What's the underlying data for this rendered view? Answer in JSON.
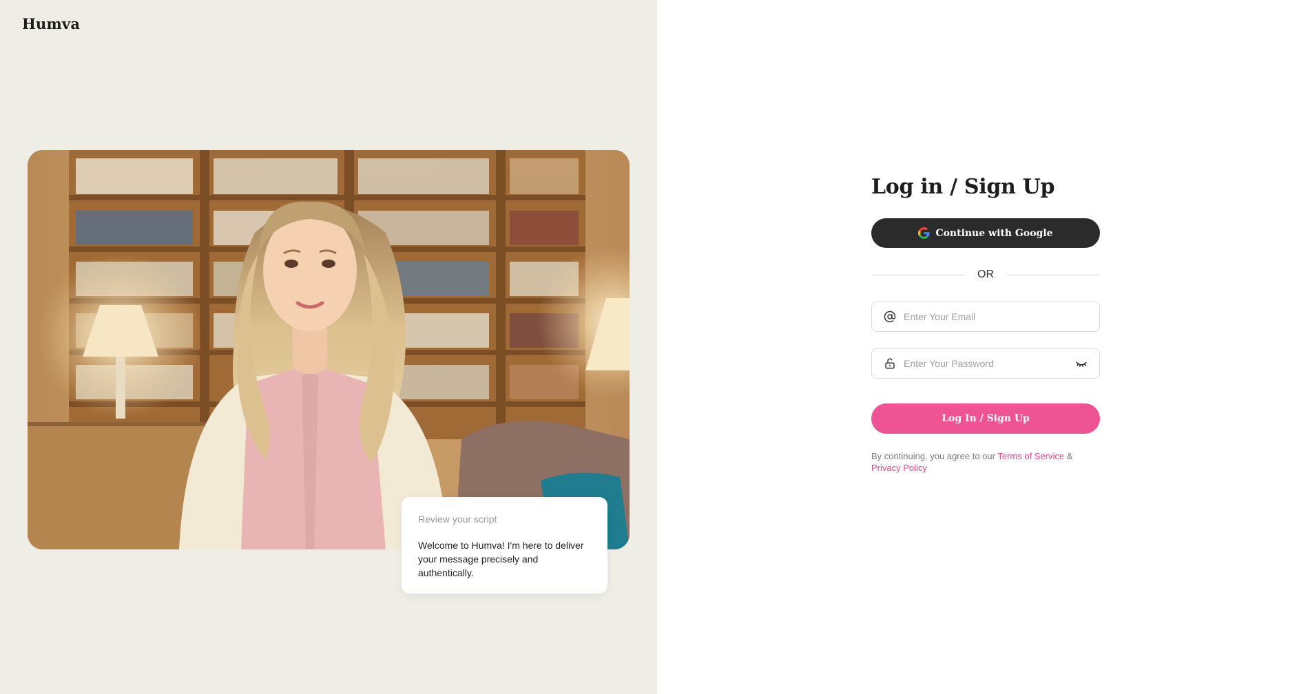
{
  "brand": {
    "name": "Humva"
  },
  "hero": {
    "script_card": {
      "title": "Review your script",
      "text": "Welcome to Humva! I'm here to deliver your message precisely and authentically."
    }
  },
  "auth": {
    "heading": "Log in / Sign Up",
    "google_button": {
      "label": "Continue with Google",
      "icon": "google-icon"
    },
    "divider_text": "OR",
    "email": {
      "placeholder": "Enter Your Email",
      "value": "",
      "icon": "at-sign-icon"
    },
    "password": {
      "placeholder": "Enter Your Password",
      "value": "",
      "icon": "lock-icon",
      "toggle_icon": "eye-closed-icon"
    },
    "submit_label": "Log In / Sign Up",
    "terms": {
      "prefix": "By continuing, you agree to our",
      "terms_link": "Terms of Service",
      "joiner": "&",
      "privacy_link": "Privacy Policy"
    }
  },
  "colors": {
    "left_panel_bg": "#efeee6",
    "primary_dark": "#2b2b2b",
    "accent_pink": "#ee5394",
    "link_pink": "#d94a87"
  }
}
